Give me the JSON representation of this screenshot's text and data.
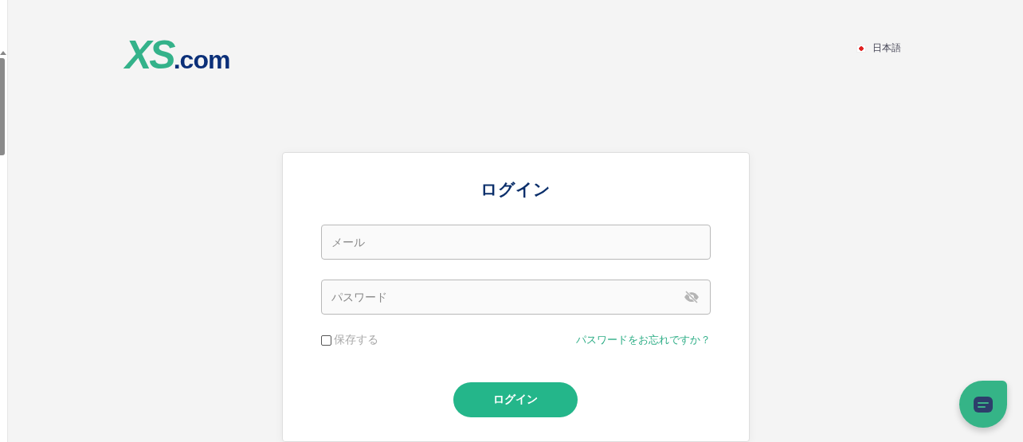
{
  "logo": {
    "mark": "XS",
    "suffix": ".com"
  },
  "language": {
    "label": "日本語"
  },
  "login_form": {
    "title": "ログイン",
    "email_field": {
      "placeholder": "メール"
    },
    "password_field": {
      "placeholder": "パスワード",
      "visible": false
    },
    "remember": {
      "label": "保存する",
      "checked": false
    },
    "forgot_link": "パスワードをお忘れですか？",
    "submit_button": "ログイン"
  }
}
